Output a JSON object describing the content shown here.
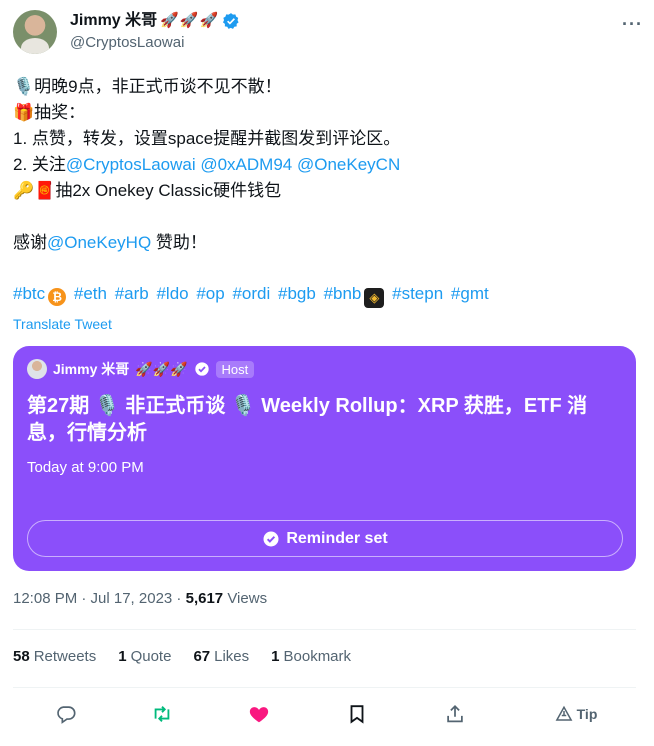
{
  "author": {
    "display_name": "Jimmy 米哥",
    "badges": "🚀🚀🚀",
    "handle": "@CryptosLaowai"
  },
  "tweet": {
    "line1": "🎙️明晚9点，非正式币谈不见不散！",
    "line2": "🎁抽奖：",
    "line3": "1. 点赞，转发，设置space提醒并截图发到评论区。",
    "line4_prefix": "2. 关注",
    "mentions": [
      "@CryptosLaowai",
      "@0xADM94",
      "@OneKeyCN"
    ],
    "line5": "🔑🧧抽2x Onekey Classic硬件钱包",
    "thanks_prefix": "感谢",
    "thanks_mention": "@OneKeyHQ",
    "thanks_suffix": " 赞助！",
    "hashtags": [
      "#btc",
      "#eth",
      "#arb",
      "#ldo",
      "#op",
      "#ordi",
      "#bgb",
      "#bnb",
      "#stepn",
      "#gmt"
    ],
    "translate_label": "Translate Tweet"
  },
  "space": {
    "host_name": "Jimmy 米哥",
    "host_badges": "🚀🚀🚀",
    "host_label": "Host",
    "title": "第27期 🎙️ 非正式币谈 🎙️ Weekly Rollup：XRP 获胜，ETF 消息，行情分析",
    "time": "Today at 9:00 PM",
    "reminder_label": "Reminder set",
    "background_color": "#8b4ffa"
  },
  "meta": {
    "timestamp": "12:08 PM · Jul 17, 2023 · ",
    "views_count": "5,617",
    "views_label": " Views"
  },
  "stats": {
    "retweets_count": "58",
    "retweets_label": "Retweets",
    "quotes_count": "1",
    "quotes_label": "Quote",
    "likes_count": "67",
    "likes_label": "Likes",
    "bookmarks_count": "1",
    "bookmarks_label": "Bookmark"
  },
  "actions": {
    "reply_icon": "reply-icon",
    "retweet_icon": "retweet-icon",
    "like_icon": "heart-icon",
    "bookmark_icon": "bookmark-icon",
    "share_icon": "share-icon",
    "tip_label": "Tip"
  },
  "colors": {
    "accent": "#1d9bf0",
    "retweet_green": "#00ba7c",
    "like_pink": "#f91880",
    "secondary_text": "#536471"
  }
}
